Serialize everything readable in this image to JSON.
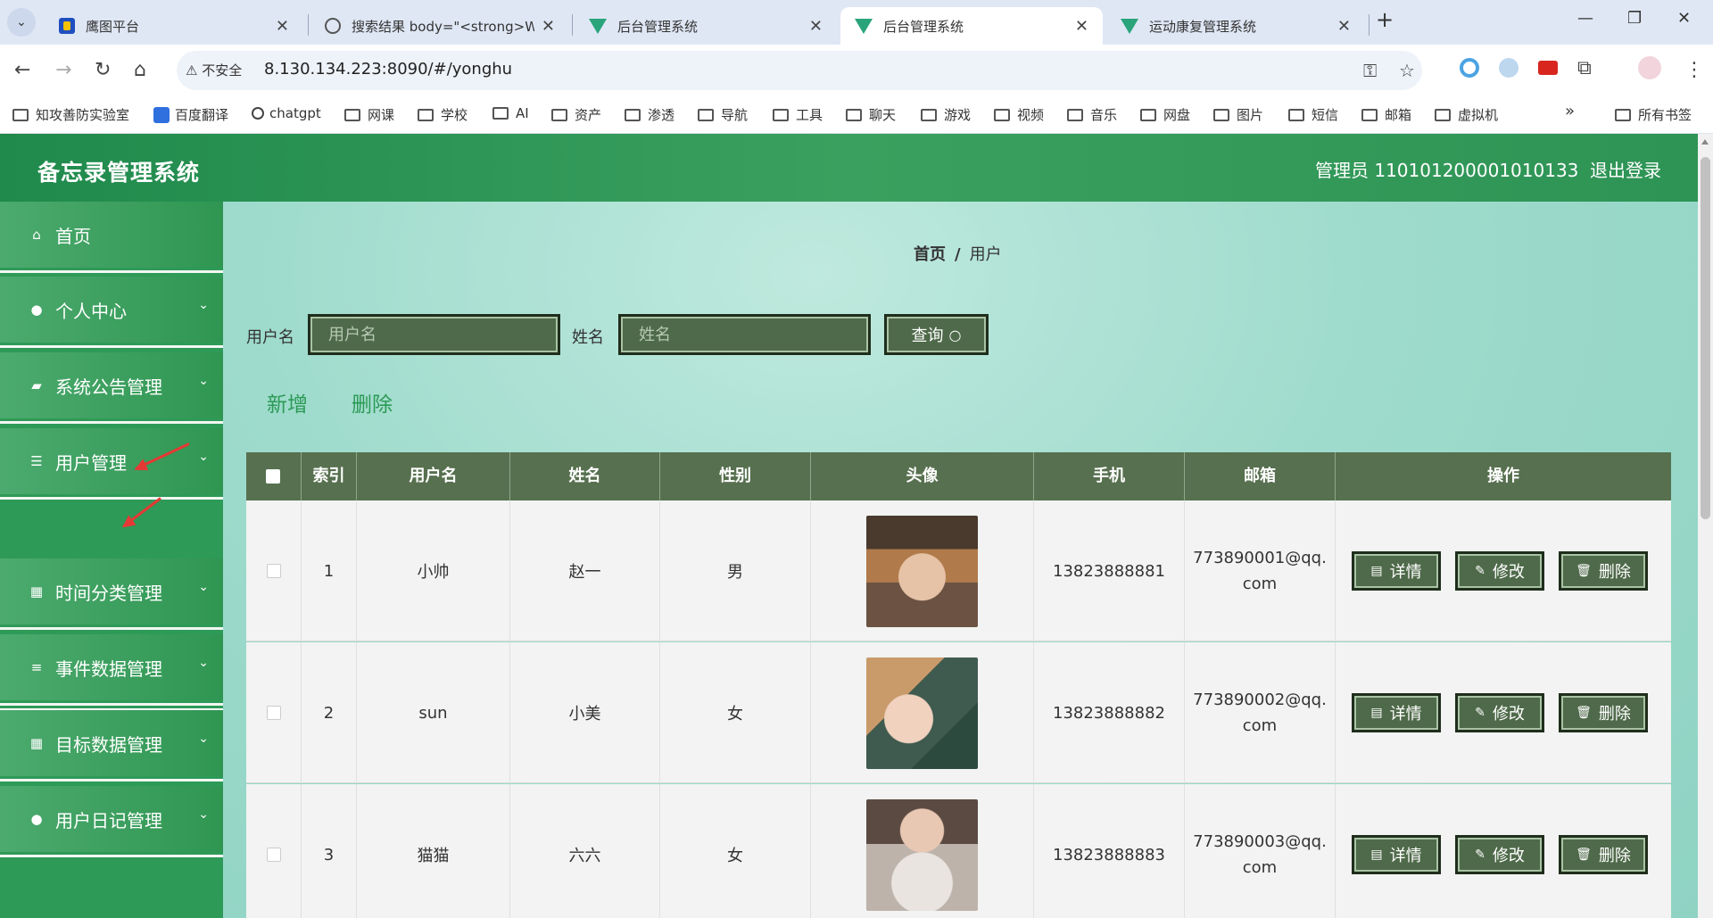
{
  "browser": {
    "tabs": [
      {
        "title": "鹰图平台",
        "active": false
      },
      {
        "title": "搜索结果 body=\"<strong>Wo",
        "active": false
      },
      {
        "title": "后台管理系统",
        "active": false
      },
      {
        "title": "后台管理系统",
        "active": true
      },
      {
        "title": "运动康复管理系统",
        "active": false
      }
    ],
    "new_tab": "+",
    "minimize": "—",
    "restore": "❐",
    "close": "✕",
    "security_label": "⚠ 不安全",
    "url": "8.130.134.223:8090/#/yonghu",
    "bookmarks": [
      "知攻善防实验室",
      "百度翻译",
      "chatgpt",
      "网课",
      "学校",
      "AI",
      "资产",
      "渗透",
      "导航",
      "工具",
      "聊天",
      "游戏",
      "视频",
      "音乐",
      "网盘",
      "图片",
      "短信",
      "邮箱",
      "虚拟机"
    ],
    "bookmarks_more": "»",
    "all_bookmarks": "所有书签"
  },
  "app": {
    "title": "备忘录管理系统",
    "admin_label": "管理员 110101200001010133",
    "logout": "退出登录"
  },
  "sidebar": {
    "items": [
      {
        "label": "首页",
        "icon": "home-icon",
        "has_children": false
      },
      {
        "label": "个人中心",
        "icon": "user-icon",
        "has_children": true
      },
      {
        "label": "系统公告管理",
        "icon": "briefcase-icon",
        "has_children": true
      },
      {
        "label": "用户管理",
        "icon": "sliders-icon",
        "has_children": true
      },
      {
        "label": "时间分类管理",
        "icon": "grid-icon",
        "has_children": true
      },
      {
        "label": "事件数据管理",
        "icon": "list-icon",
        "has_children": true
      },
      {
        "label": "目标数据管理",
        "icon": "grid-icon",
        "has_children": true
      },
      {
        "label": "用户日记管理",
        "icon": "lightbulb-icon",
        "has_children": true
      }
    ],
    "submenu": {
      "label": "用户"
    }
  },
  "breadcrumb": {
    "home": "首页",
    "separator": "/",
    "current": "用户"
  },
  "filters": {
    "username_label": "用户名",
    "username_placeholder": "用户名",
    "name_label": "姓名",
    "name_placeholder": "姓名",
    "query_label": "查询"
  },
  "actions": {
    "add": "新增",
    "delete": "删除"
  },
  "table": {
    "columns": [
      "索引",
      "用户名",
      "姓名",
      "性别",
      "头像",
      "手机",
      "邮箱",
      "操作"
    ],
    "rows": [
      {
        "index": "1",
        "username": "小帅",
        "name": "赵一",
        "gender": "男",
        "phone": "13823888881",
        "email_line1": "773890001@qq.",
        "email_line2": "com"
      },
      {
        "index": "2",
        "username": "sun",
        "name": "小美",
        "gender": "女",
        "phone": "13823888882",
        "email_line1": "773890002@qq.",
        "email_line2": "com"
      },
      {
        "index": "3",
        "username": "猫猫",
        "name": "六六",
        "gender": "女",
        "phone": "13823888883",
        "email_line1": "773890003@qq.",
        "email_line2": "com"
      }
    ],
    "row_actions": {
      "detail": "详情",
      "edit": "修改",
      "delete": "删除"
    }
  },
  "colors": {
    "header_green": "#2e9455",
    "button_green": "#4f6a4a",
    "table_head": "#57704f",
    "link_green": "#2b9a55",
    "annotation_red": "#e53935"
  }
}
